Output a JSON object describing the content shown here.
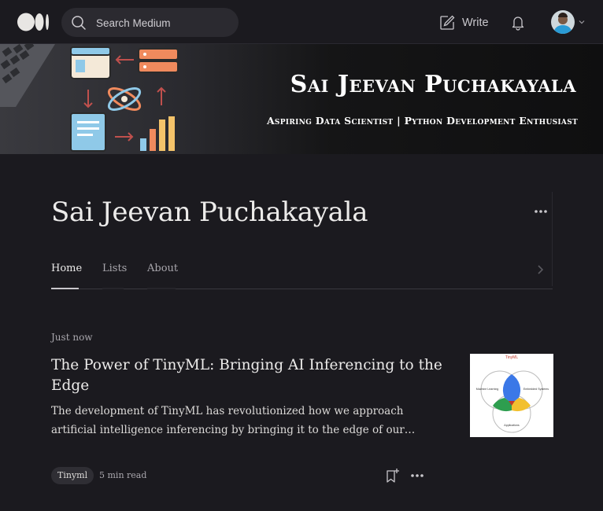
{
  "nav": {
    "logo_icon": "medium-logo-icon",
    "search_placeholder": "Search Medium",
    "write_label": "Write",
    "bell_icon": "bell-icon"
  },
  "banner": {
    "name": "Sai Jeevan Puchakayala",
    "tagline": "Aspiring Data Scientist | Python Development Enthusiast"
  },
  "profile": {
    "name": "Sai Jeevan Puchakayala",
    "tabs": [
      "Home",
      "Lists",
      "About"
    ],
    "active_tab": "Home"
  },
  "post": {
    "time": "Just now",
    "title": "The Power of TinyML: Bringing AI Inferencing to the Edge",
    "subtitle": "The development of TinyML has revolutionized how we approach artificial intelligence inferencing by bringing it to the edge of our devices. This new approach to AI is rapidly gaining momentum",
    "tag": "Tinyml",
    "read_time": "5 min read",
    "thumbnail": {
      "title": "TinyML",
      "left_circle": "Machine Learning",
      "right_circle": "Embedded Systems",
      "bottom_circle": "Applications"
    }
  },
  "colors": {
    "background": "#1b1a1f",
    "text": "#ecebea",
    "muted": "#a9a7ad"
  }
}
